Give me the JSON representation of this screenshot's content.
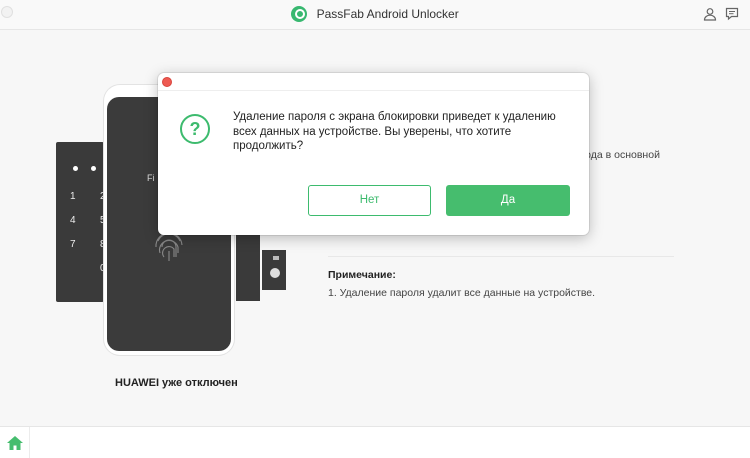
{
  "window": {
    "title": "PassFab Android Unlocker",
    "icons": [
      "user-icon",
      "feedback-icon"
    ]
  },
  "illustration": {
    "keypad_keys": [
      "1",
      "2",
      "4",
      "5",
      "7",
      "8",
      "0"
    ],
    "phone_text": "Fi",
    "caption": "HUAWEI уже отключен"
  },
  "info": {
    "partial_text": "хода в основной",
    "note_title": "Примечание:",
    "note_items": [
      "1. Удаление пароля удалит все данные на устройстве."
    ]
  },
  "dialog": {
    "icon": "question-icon",
    "message": "Удаление пароля с экрана блокировки приведет к удалению всех данных на устройстве. Вы уверены, что хотите продолжить?",
    "cancel_label": "Нет",
    "confirm_label": "Да"
  },
  "footer": {
    "home_icon": "home-icon"
  },
  "colors": {
    "accent": "#46bd6e",
    "close_dot": "#ee5a52",
    "phone_dark": "#3b3b3b"
  }
}
